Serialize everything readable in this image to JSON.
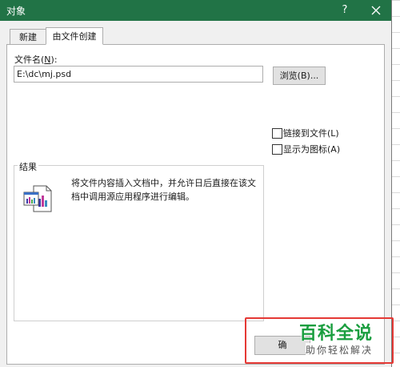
{
  "window": {
    "title": "对象",
    "help_label": "?",
    "close_icon": "close-icon"
  },
  "tabs": [
    {
      "label": "新建",
      "selected": false
    },
    {
      "label": "由文件创建",
      "selected": true
    }
  ],
  "file": {
    "label_prefix": "文件名(",
    "label_key": "N",
    "label_suffix": "):",
    "value": "E:\\dc\\mj.psd",
    "browse_label": "浏览(B)..."
  },
  "options": {
    "link_label": "链接到文件(L)",
    "link_checked": false,
    "icon_label": "显示为图标(A)",
    "icon_checked": false
  },
  "result": {
    "legend": "结果",
    "icon": "embedded-object-icon",
    "description": "将文件内容插入文档中，并允许日后直接在该文档中调用源应用程序进行编辑。"
  },
  "buttons": {
    "ok_label": "确"
  },
  "watermark": {
    "main": "百科全说",
    "sub": "助你轻松解决"
  },
  "colors": {
    "titlebar": "#217346",
    "highlight": "#e53935",
    "watermark_green": "#1a9e3f"
  }
}
